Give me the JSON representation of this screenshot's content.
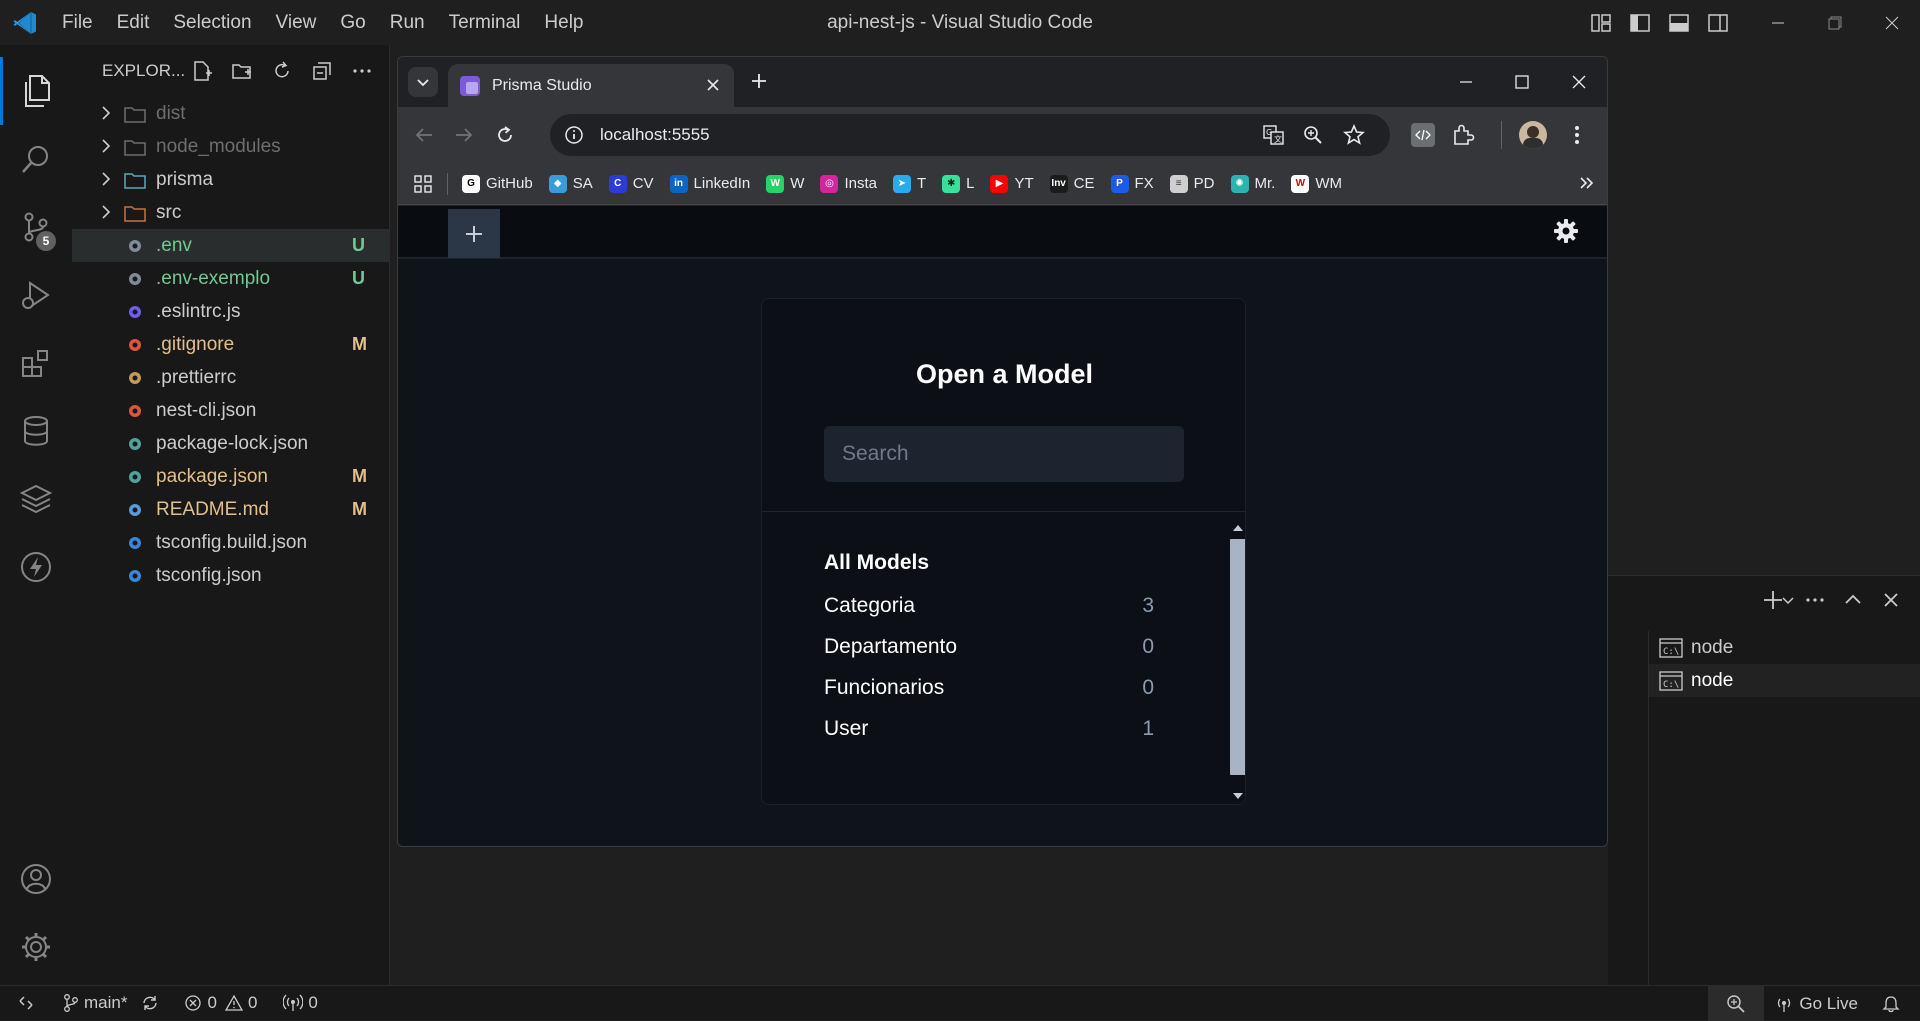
{
  "window": {
    "title": "api-nest-js - Visual Studio Code",
    "menu": [
      "File",
      "Edit",
      "Selection",
      "View",
      "Go",
      "Run",
      "Terminal",
      "Help"
    ]
  },
  "activity": {
    "scm_badge": "5"
  },
  "explorer": {
    "header": "EXPLOR...",
    "items": [
      {
        "name": "dist",
        "kind": "folder",
        "status": "",
        "color": "#6e6e6e",
        "icon_color": "#6e6e6e"
      },
      {
        "name": "node_modules",
        "kind": "folder",
        "status": "",
        "color": "#6e6e6e",
        "icon_color": "#6e6e6e"
      },
      {
        "name": "prisma",
        "kind": "folder",
        "status": "",
        "color": "#cccccc",
        "icon_color": "#5fa8b5"
      },
      {
        "name": "src",
        "kind": "folder",
        "status": "",
        "color": "#cccccc",
        "icon_color": "#cb6f3f"
      },
      {
        "name": ".env",
        "kind": "file",
        "status": "U",
        "color": "#73c991",
        "icon_color": "#7f8c97"
      },
      {
        "name": ".env-exemplo",
        "kind": "file",
        "status": "U",
        "color": "#73c991",
        "icon_color": "#7f8c97"
      },
      {
        "name": ".eslintrc.js",
        "kind": "file",
        "status": "",
        "color": "#cccccc",
        "icon_color": "#6f5df0"
      },
      {
        "name": ".gitignore",
        "kind": "file",
        "status": "M",
        "color": "#e2c08d",
        "icon_color": "#e0533d"
      },
      {
        "name": ".prettierrc",
        "kind": "file",
        "status": "",
        "color": "#cccccc",
        "icon_color": "#c49a55"
      },
      {
        "name": "nest-cli.json",
        "kind": "file",
        "status": "",
        "color": "#cccccc",
        "icon_color": "#e0533d"
      },
      {
        "name": "package-lock.json",
        "kind": "file",
        "status": "",
        "color": "#cccccc",
        "icon_color": "#4fa39a"
      },
      {
        "name": "package.json",
        "kind": "file",
        "status": "M",
        "color": "#e2c08d",
        "icon_color": "#4fa39a"
      },
      {
        "name": "README.md",
        "kind": "file",
        "status": "M",
        "color": "#e2c08d",
        "icon_color": "#5a9ad8"
      },
      {
        "name": "tsconfig.build.json",
        "kind": "file",
        "status": "",
        "color": "#cccccc",
        "icon_color": "#3a86d6"
      },
      {
        "name": "tsconfig.json",
        "kind": "file",
        "status": "",
        "color": "#cccccc",
        "icon_color": "#3a86d6"
      }
    ]
  },
  "terminal": {
    "items": [
      "node",
      "node"
    ]
  },
  "statusbar": {
    "branch": "main*",
    "errors": "0",
    "warnings": "0",
    "ports": "0",
    "golive": "Go Live"
  },
  "browser": {
    "tab_title": "Prisma Studio",
    "url": "localhost:5555",
    "bookmarks": [
      {
        "label": "GitHub",
        "color": "#ffffff",
        "fg": "#000000",
        "glyph": "G"
      },
      {
        "label": "SA",
        "color": "#3a9bd9",
        "fg": "#ffffff",
        "glyph": "◆"
      },
      {
        "label": "CV",
        "color": "#2d3bd6",
        "fg": "#ffffff",
        "glyph": "C"
      },
      {
        "label": "LinkedIn",
        "color": "#0a66c2",
        "fg": "#ffffff",
        "glyph": "in"
      },
      {
        "label": "W",
        "color": "#25d366",
        "fg": "#ffffff",
        "glyph": "W"
      },
      {
        "label": "Insta",
        "color": "#d6249f",
        "fg": "#ffffff",
        "glyph": "◎"
      },
      {
        "label": "T",
        "color": "#2aabee",
        "fg": "#ffffff",
        "glyph": "➤"
      },
      {
        "label": "L",
        "color": "#39e09b",
        "fg": "#0a2a1a",
        "glyph": "✱"
      },
      {
        "label": "YT",
        "color": "#ff0000",
        "fg": "#ffffff",
        "glyph": "▶"
      },
      {
        "label": "CE",
        "color": "#1b1b1b",
        "fg": "#ffffff",
        "glyph": "Inv"
      },
      {
        "label": "FX",
        "color": "#1a5ce6",
        "fg": "#ffffff",
        "glyph": "P"
      },
      {
        "label": "PD",
        "color": "#cfcfcf",
        "fg": "#333333",
        "glyph": "≡"
      },
      {
        "label": "Mr.",
        "color": "#2bb3b0",
        "fg": "#ffffff",
        "glyph": "✺"
      },
      {
        "label": "WM",
        "color": "#ffffff",
        "fg": "#d40000",
        "glyph": "W"
      }
    ]
  },
  "prisma": {
    "title": "Open a Model",
    "search_placeholder": "Search",
    "list_header": "All Models",
    "models": [
      {
        "name": "Categoria",
        "count": "3"
      },
      {
        "name": "Departamento",
        "count": "0"
      },
      {
        "name": "Funcionarios",
        "count": "0"
      },
      {
        "name": "User",
        "count": "1"
      }
    ]
  }
}
